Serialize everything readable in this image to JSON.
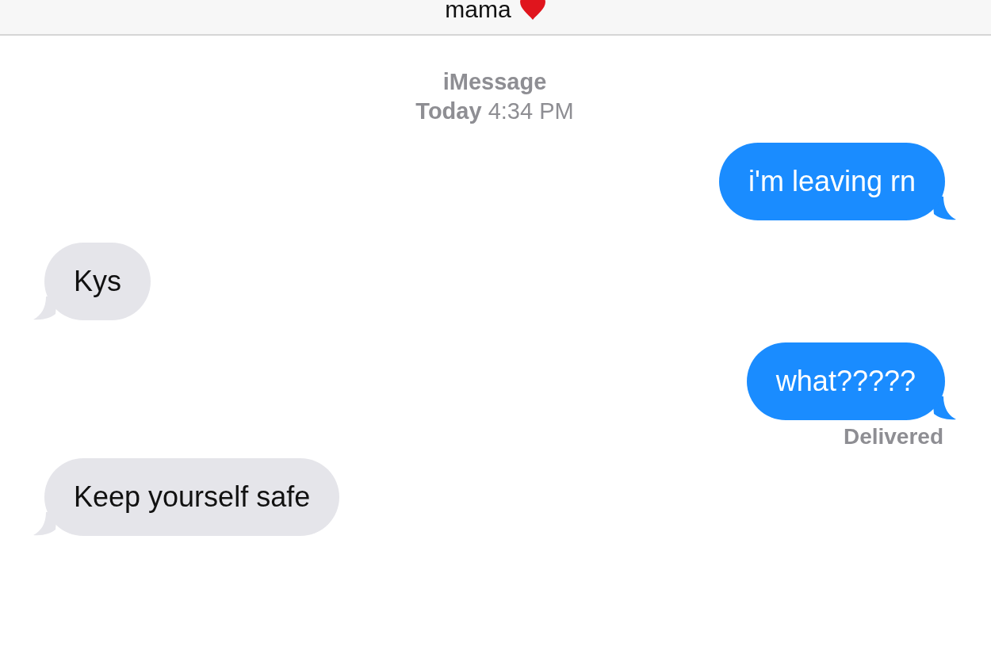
{
  "header": {
    "title": "mama"
  },
  "timestamp": {
    "service": "iMessage",
    "time": "**Today** 4:34 PM"
  },
  "messages": [
    {
      "kind": "sent",
      "text": "i'm leaving rn"
    },
    {
      "kind": "received",
      "text": "Kys"
    },
    {
      "kind": "sent",
      "text": "what?????",
      "status": "Delivered"
    },
    {
      "kind": "received",
      "text": "Keep yourself safe"
    }
  ]
}
